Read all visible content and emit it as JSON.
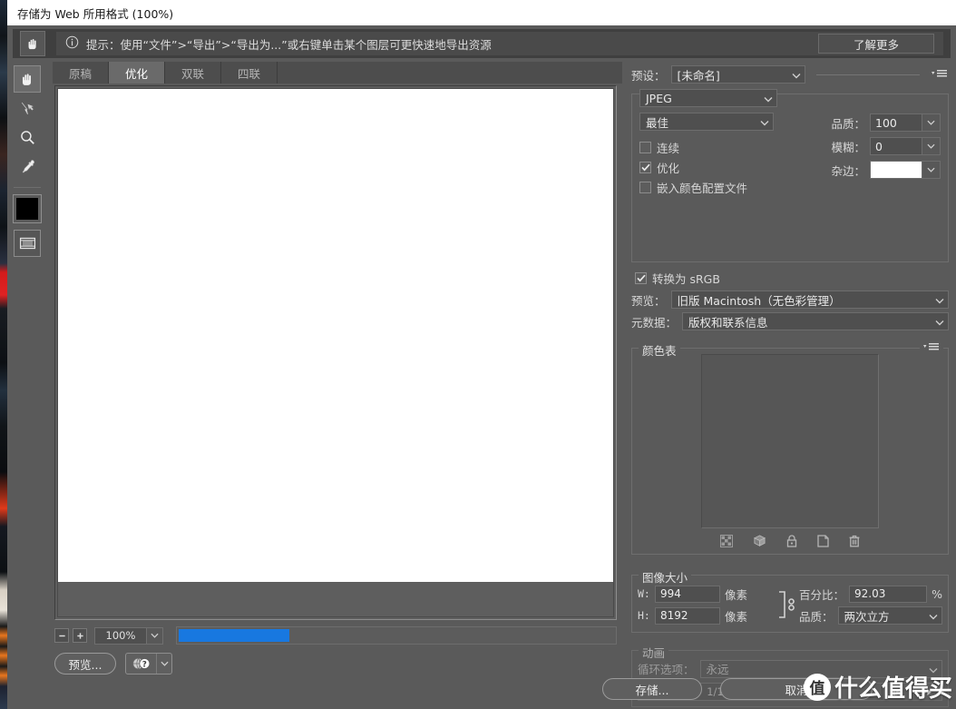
{
  "window": {
    "title": "存储为 Web 所用格式 (100%)"
  },
  "tip": {
    "icon": "info-icon",
    "text": "提示：使用“文件”>“导出”>“导出为...”或右键单击某个图层可更快速地导出资源",
    "learn_more": "了解更多",
    "hand_tool_icon": "hand-icon"
  },
  "toolbar": {
    "items": [
      {
        "name": "hand-tool",
        "icon": "hand-icon",
        "active": true
      },
      {
        "name": "slice-select-tool",
        "icon": "slice-select-icon",
        "active": false
      },
      {
        "name": "zoom-tool",
        "icon": "magnifier-icon",
        "active": false
      },
      {
        "name": "eyedropper-tool",
        "icon": "eyedropper-icon",
        "active": false
      }
    ],
    "foreground_color": "#000000",
    "toggle_slices_icon": "toggle-slices-icon"
  },
  "tabs": [
    {
      "label": "原稿",
      "active": false
    },
    {
      "label": "优化",
      "active": true
    },
    {
      "label": "双联",
      "active": false
    },
    {
      "label": "四联",
      "active": false
    }
  ],
  "preview": {
    "image_background": "#ffffff"
  },
  "statusbar": {
    "zoom_out_icon": "zoom-out-icon",
    "zoom_in_icon": "zoom-in-icon",
    "zoom_value": "100%",
    "progress_percent": 24
  },
  "footer": {
    "preview_label": "预览...",
    "help_icon": "browser-preview-icon",
    "save_label": "存储...",
    "cancel_label": "取消"
  },
  "settings": {
    "preset_label": "预设：",
    "preset_value": "[未命名]",
    "panel_menu_icon": "panel-menu-icon",
    "format": "JPEG",
    "compression_quality": "最佳",
    "quality_label": "品质：",
    "quality_value": "100",
    "blur_label": "模糊：",
    "blur_value": "0",
    "matte_label": "杂边：",
    "matte_color": "#ffffff",
    "progressive": {
      "label": "连续",
      "checked": false
    },
    "optimized": {
      "label": "优化",
      "checked": true
    },
    "embed_profile": {
      "label": "嵌入颜色配置文件",
      "checked": false
    },
    "convert_srgb": {
      "label": "转换为 sRGB",
      "checked": true
    },
    "preview_label": "预览：",
    "preview_value": "旧版 Macintosh（无色彩管理）",
    "metadata_label": "元数据：",
    "metadata_value": "版权和联系信息"
  },
  "color_table": {
    "title": "颜色表",
    "panel_menu_icon": "panel-menu-icon",
    "swatch_count": 0,
    "icons": [
      {
        "name": "transparency-icon"
      },
      {
        "name": "web-snap-cube-icon"
      },
      {
        "name": "lock-icon"
      },
      {
        "name": "new-color-icon"
      },
      {
        "name": "delete-color-icon"
      }
    ]
  },
  "image_size": {
    "title": "图像大小",
    "width_label": "W:",
    "width_value": "994",
    "width_unit": "像素",
    "height_label": "H:",
    "height_value": "8192",
    "height_unit": "像素",
    "link_icon": "chain-link-icon",
    "percent_label": "百分比：",
    "percent_value": "92.03",
    "percent_unit": "%",
    "quality_label": "品质：",
    "quality_value": "两次立方"
  },
  "animation": {
    "title": "动画",
    "loop_label": "循环选项：",
    "loop_value": "永远",
    "frame_counter": "1/1",
    "buttons": [
      {
        "name": "first-frame-button",
        "icon": "skip-back-icon"
      },
      {
        "name": "previous-frame-button",
        "icon": "step-back-icon"
      },
      {
        "name": "play-button",
        "icon": "play-icon"
      },
      {
        "name": "next-frame-button",
        "icon": "step-forward-icon"
      },
      {
        "name": "last-frame-button",
        "icon": "skip-forward-icon"
      }
    ]
  },
  "watermark": {
    "badge": "值",
    "text": "什么值得买"
  }
}
